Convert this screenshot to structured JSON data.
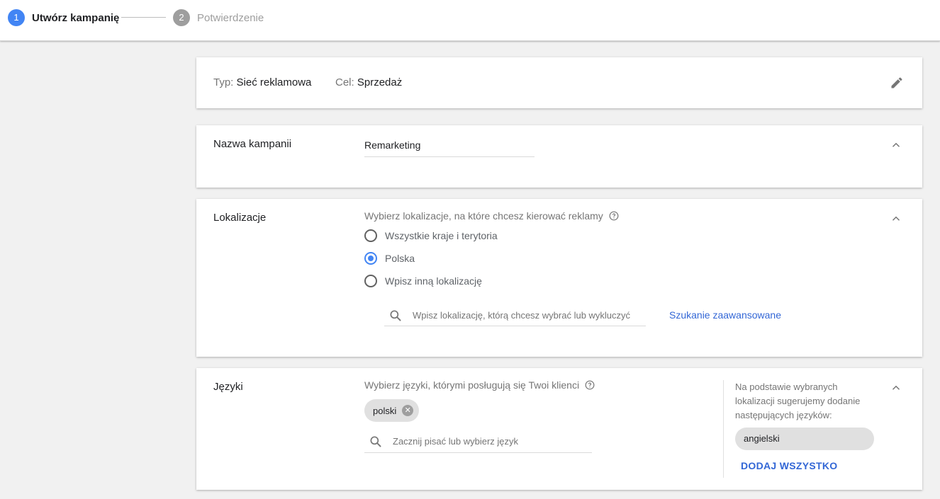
{
  "stepper": {
    "steps": [
      {
        "number": "1",
        "label": "Utwórz kampanię"
      },
      {
        "number": "2",
        "label": "Potwierdzenie"
      }
    ]
  },
  "summary": {
    "type_label": "Typ:",
    "type_value": "Sieć reklamowa",
    "goal_label": "Cel:",
    "goal_value": "Sprzedaż",
    "edit_icon": "pencil-icon"
  },
  "campaign_name": {
    "title": "Nazwa kampanii",
    "value": "Remarketing"
  },
  "locations": {
    "title": "Lokalizacje",
    "hint": "Wybierz lokalizacje, na które chcesz kierować reklamy",
    "options": [
      {
        "label": "Wszystkie kraje i terytoria",
        "selected": false
      },
      {
        "label": "Polska",
        "selected": true
      },
      {
        "label": "Wpisz inną lokalizację",
        "selected": false
      }
    ],
    "search_placeholder": "Wpisz lokalizację, którą chcesz wybrać lub wykluczyć",
    "advanced_link": "Szukanie zaawansowane"
  },
  "languages": {
    "title": "Języki",
    "hint": "Wybierz języki, którymi posługują się Twoi klienci",
    "selected_chip": "polski",
    "search_placeholder": "Zacznij pisać lub wybierz język",
    "suggestion_text": "Na podstawie wybranych lokalizacji sugerujemy dodanie następujących języków:",
    "suggested_chip": "angielski",
    "add_all_button": "DODAJ WSZYSTKO"
  },
  "colors": {
    "accent": "#4285f4",
    "link": "#3367d6",
    "inactive": "#9e9e9e"
  }
}
